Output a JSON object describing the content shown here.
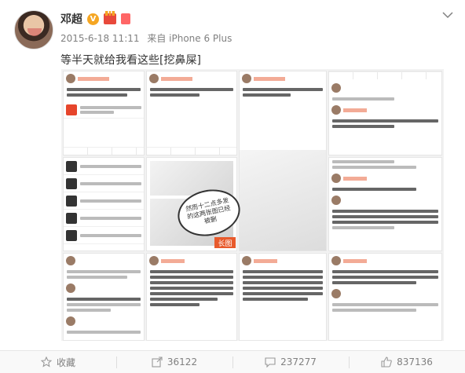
{
  "post": {
    "user_name": "邓超",
    "badge_v": "V",
    "badge_vip": "",
    "time": "2015-6-18 11:11",
    "source": "来自 iPhone 6 Plus",
    "text": "等半天就给我看这些[挖鼻屎]",
    "image_bubble_text": "然而十二点多发的这两张图已经被删",
    "image_badge": "长图"
  },
  "actions": [
    {
      "label": "收藏",
      "icon": "star-icon"
    },
    {
      "label": "36122",
      "icon": "share-icon"
    },
    {
      "label": "237277",
      "icon": "comment-icon"
    },
    {
      "label": "837136",
      "icon": "like-icon"
    }
  ],
  "colors": {
    "name": "#333333",
    "meta": "#808080",
    "accent": "#eb7350",
    "badge_v": "#f5a623",
    "long_badge": "#e85a2c"
  }
}
